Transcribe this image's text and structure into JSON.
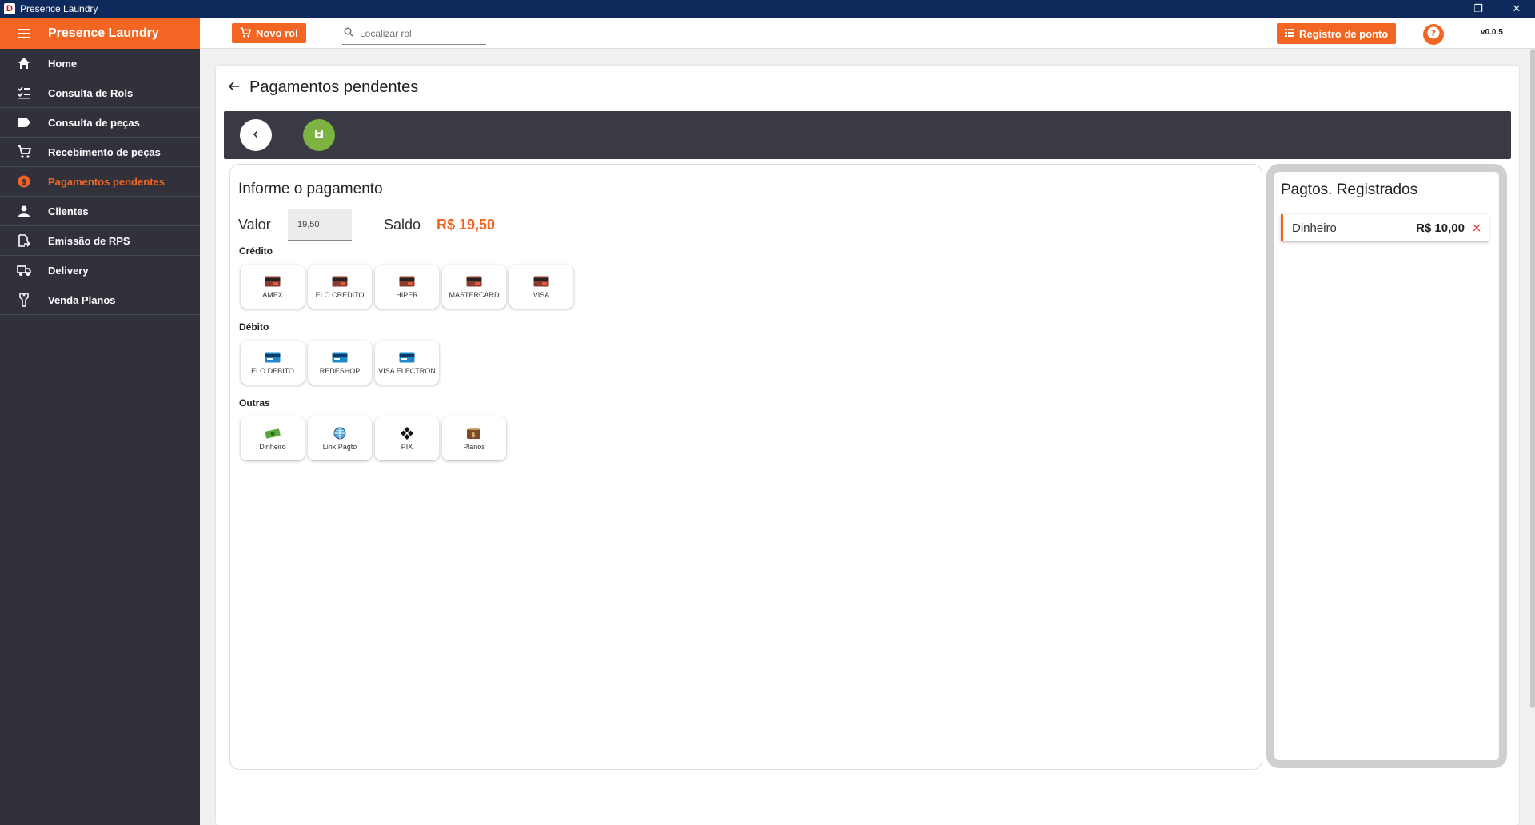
{
  "window": {
    "title": "Presence Laundry",
    "app_icon": "D"
  },
  "sidebar": {
    "brand": "Presence Laundry",
    "items": [
      {
        "label": "Home",
        "icon": "home-icon",
        "active": false
      },
      {
        "label": "Consulta de Rols",
        "icon": "checklist-icon",
        "active": false
      },
      {
        "label": "Consulta de peças",
        "icon": "tag-icon",
        "active": false
      },
      {
        "label": "Recebimento de peças",
        "icon": "cart-icon",
        "active": false
      },
      {
        "label": "Pagamentos pendentes",
        "icon": "dollar-icon",
        "active": true
      },
      {
        "label": "Clientes",
        "icon": "person-icon",
        "active": false
      },
      {
        "label": "Emissão de RPS",
        "icon": "document-export-icon",
        "active": false
      },
      {
        "label": "Delivery",
        "icon": "truck-icon",
        "active": false
      },
      {
        "label": "Venda Planos",
        "icon": "hanger-icon",
        "active": false
      }
    ]
  },
  "topbar": {
    "new_rol_label": "Novo rol",
    "search_placeholder": "Localizar rol",
    "registro_label": "Registro de ponto",
    "version": "v0.0.5"
  },
  "page": {
    "title": "Pagamentos pendentes",
    "pay": {
      "title": "Informe o pagamento",
      "valor_label": "Valor",
      "valor_value": "19,50",
      "saldo_label": "Saldo",
      "saldo_value": "R$ 19,50"
    },
    "credito": {
      "title": "Crédito",
      "items": [
        "AMEX",
        "ELO CREDITO",
        "HIPER",
        "MASTERCARD",
        "VISA"
      ]
    },
    "debito": {
      "title": "Débito",
      "items": [
        "ELO DEBITO",
        "REDESHOP",
        "VISA ELECTRON"
      ]
    },
    "outras": {
      "title": "Outras",
      "items": [
        "Dinheiro",
        "Link Pagto",
        "PIX",
        "Planos"
      ]
    },
    "registrados": {
      "title": "Pagtos. Registrados",
      "items": [
        {
          "method": "Dinheiro",
          "amount": "R$ 10,00"
        }
      ]
    }
  },
  "colors": {
    "accent": "#f26522",
    "sidebar": "#30313b",
    "titlebar": "#0e2a5c",
    "save": "#7cb342"
  }
}
